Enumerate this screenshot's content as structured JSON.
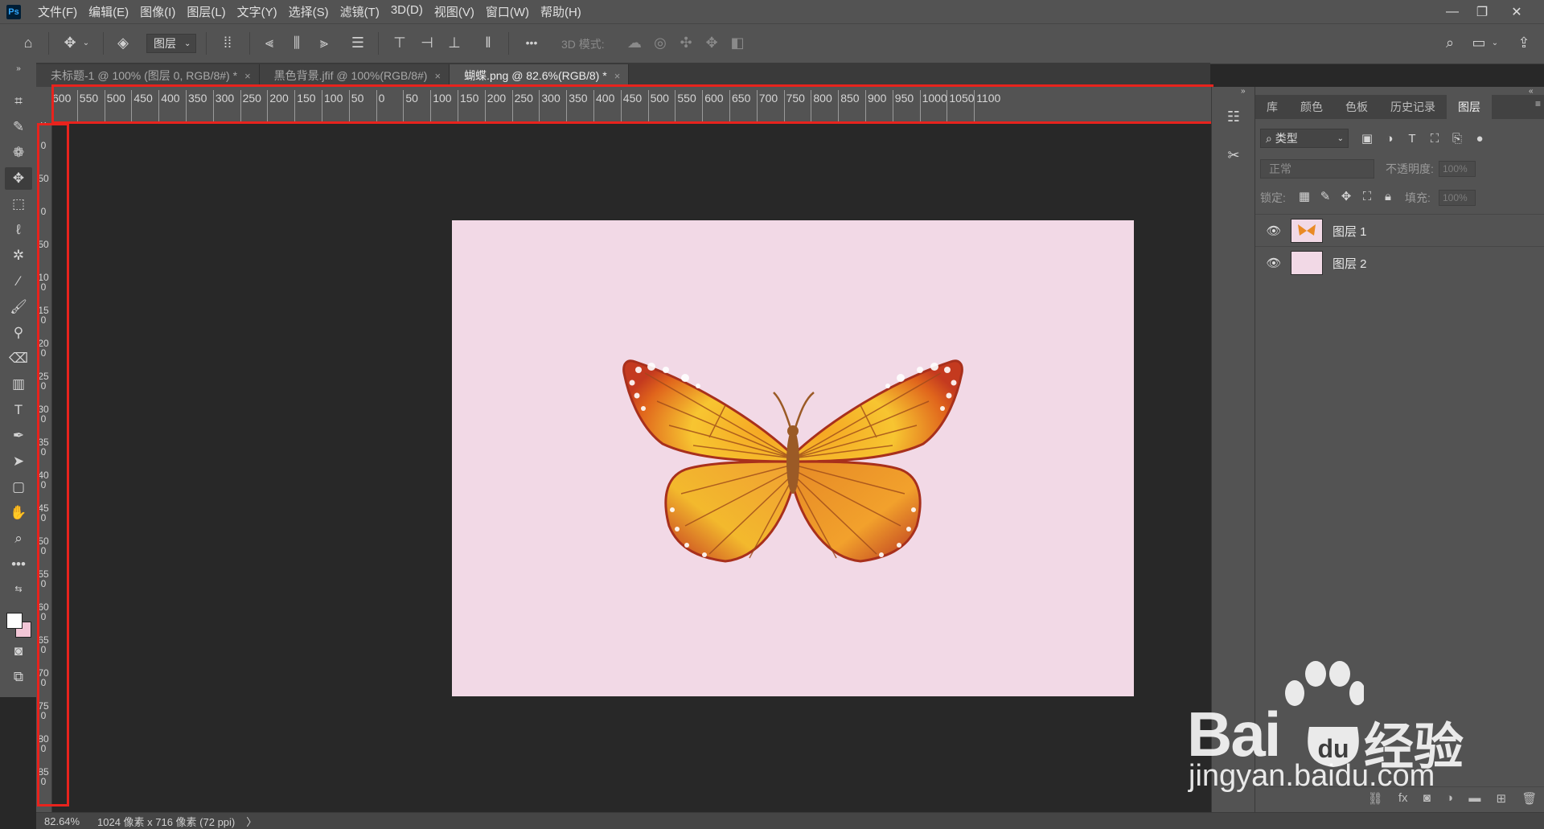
{
  "app": {
    "logo": "Ps"
  },
  "menu": [
    "文件(F)",
    "编辑(E)",
    "图像(I)",
    "图层(L)",
    "文字(Y)",
    "选择(S)",
    "滤镜(T)",
    "3D(D)",
    "视图(V)",
    "窗口(W)",
    "帮助(H)"
  ],
  "window_controls": {
    "minimize": "—",
    "restore": "❐",
    "close": "✕"
  },
  "options_bar": {
    "layer_select": "图层",
    "mode_3d": "3D 模式:",
    "more": "•••"
  },
  "tabs": [
    {
      "label": "未标题-1 @ 100% (图层 0, RGB/8#) *",
      "active": false
    },
    {
      "label": "黑色背景.jfif @ 100%(RGB/8#)",
      "active": false
    },
    {
      "label": "蝴蝶.png @ 82.6%(RGB/8) *",
      "active": true
    }
  ],
  "tab_close": "×",
  "ruler_top_labels": [
    "600",
    "550",
    "500",
    "450",
    "400",
    "350",
    "300",
    "250",
    "200",
    "150",
    "100",
    "50",
    "0",
    "50",
    "100",
    "150",
    "200",
    "250",
    "300",
    "350",
    "400",
    "450",
    "500",
    "550",
    "600",
    "650",
    "700",
    "750",
    "800",
    "850",
    "900",
    "950",
    "1000",
    "1050",
    "1100"
  ],
  "ruler_left_labels": [
    "100",
    "0",
    "50",
    "0",
    "50",
    "100",
    "150",
    "200",
    "250",
    "300",
    "350",
    "400",
    "450",
    "500",
    "550",
    "600",
    "650",
    "700",
    "750",
    "800",
    "850"
  ],
  "panels": {
    "tabs": [
      "库",
      "颜色",
      "色板",
      "历史记录",
      "图层"
    ],
    "active_tab": "图层",
    "filter_label": "类型",
    "blend_mode": "正常",
    "opacity_label": "不透明度:",
    "opacity_value": "100%",
    "lock_label": "锁定:",
    "fill_label": "填充:",
    "fill_value": "100%",
    "layers": [
      {
        "name": "图层 1",
        "visible": true
      },
      {
        "name": "图层 2",
        "visible": true
      }
    ]
  },
  "status": {
    "zoom": "82.64%",
    "doc_info": "1024 像素 x 716 像素 (72 ppi)",
    "arrow": "〉"
  },
  "canvas": {
    "background_color": "#f2d9e6"
  },
  "watermark": {
    "brand": "Bai",
    "brand_cn": "经验",
    "url": "jingyan.baidu.com"
  },
  "colors": {
    "highlight": "#e8231d",
    "foreground": "#ffffff",
    "background": "#f2c6d6"
  }
}
